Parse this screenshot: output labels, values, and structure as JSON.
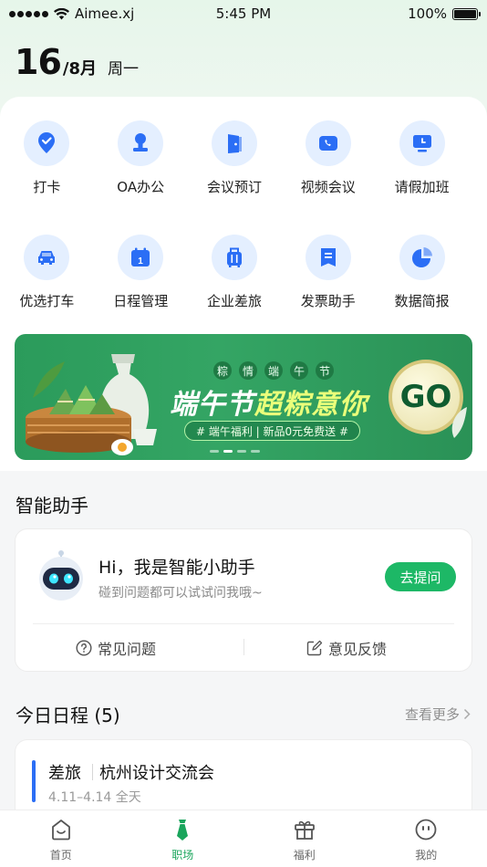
{
  "status_bar": {
    "carrier": "Aimee.xj",
    "time": "5:45 PM",
    "battery": "100%"
  },
  "date": {
    "day": "16",
    "month": "/8月",
    "weekday": "周一"
  },
  "apps": [
    {
      "label": "打卡",
      "icon": "check-location-icon"
    },
    {
      "label": "OA办公",
      "icon": "stamp-icon"
    },
    {
      "label": "会议预订",
      "icon": "door-icon"
    },
    {
      "label": "视频会议",
      "icon": "video-call-icon"
    },
    {
      "label": "请假加班",
      "icon": "monitor-icon"
    },
    {
      "label": "优选打车",
      "icon": "car-icon"
    },
    {
      "label": "日程管理",
      "icon": "calendar-icon"
    },
    {
      "label": "企业差旅",
      "icon": "luggage-icon"
    },
    {
      "label": "发票助手",
      "icon": "invoice-icon"
    },
    {
      "label": "数据简报",
      "icon": "pie-chart-icon"
    }
  ],
  "banner": {
    "subtitle_chars": [
      "粽",
      "情",
      "端",
      "午",
      "节"
    ],
    "title_a": "端午节",
    "title_b": "超粽意你",
    "tag": "# 端午福利 | 新品0元免费送 #",
    "go": "GO",
    "pages": 4,
    "active_page": 2
  },
  "assistant_section": {
    "title": "智能助手",
    "greeting": "Hi，我是智能小助手",
    "subtitle": "碰到问题都可以试试问我哦~",
    "ask_button": "去提问",
    "faq": "常见问题",
    "feedback": "意见反馈"
  },
  "schedule": {
    "title": "今日日程 (5)",
    "see_more": "查看更多",
    "items": [
      {
        "type": "差旅",
        "title": "杭州设计交流会",
        "date": "4.11–4.14 全天"
      }
    ]
  },
  "tabbar": [
    {
      "label": "首页",
      "icon": "home-icon"
    },
    {
      "label": "职场",
      "icon": "tie-icon"
    },
    {
      "label": "福利",
      "icon": "gift-icon"
    },
    {
      "label": "我的",
      "icon": "smiley-icon"
    }
  ],
  "colors": {
    "accent": "#1db866",
    "icon_blue": "#2b6ef5",
    "icon_bg": "#e4efff"
  }
}
